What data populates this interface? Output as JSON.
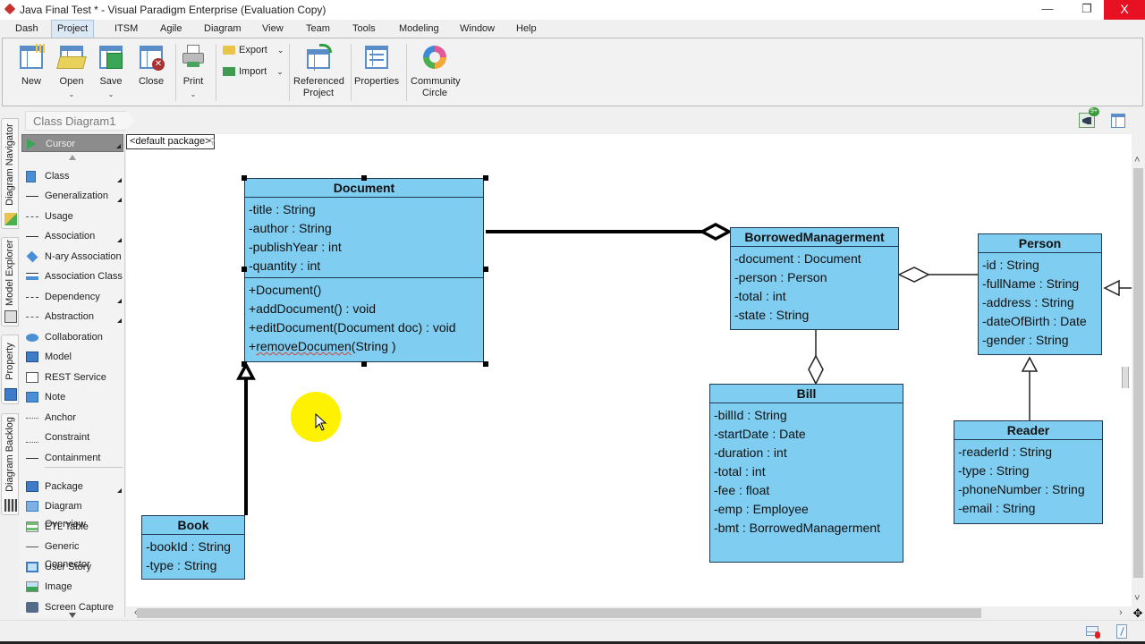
{
  "window": {
    "title": "Java Final Test * - Visual Paradigm Enterprise (Evaluation Copy)",
    "minimize": "—",
    "restore": "❐",
    "close": "X"
  },
  "menu": [
    {
      "label": "Dash"
    },
    {
      "label": "Project",
      "active": true
    },
    {
      "label": "ITSM"
    },
    {
      "label": "Agile"
    },
    {
      "label": "Diagram"
    },
    {
      "label": "View"
    },
    {
      "label": "Team"
    },
    {
      "label": "Tools"
    },
    {
      "label": "Modeling"
    },
    {
      "label": "Window"
    },
    {
      "label": "Help"
    }
  ],
  "ribbon": {
    "new": "New",
    "open": "Open",
    "save": "Save",
    "close": "Close",
    "print": "Print",
    "export": "Export",
    "import": "Import",
    "referenced_project_line1": "Referenced",
    "referenced_project_line2": "Project",
    "properties": "Properties",
    "community_line1": "Community",
    "community_line2": "Circle",
    "dropdown_glyph": "⌄",
    "notification_badge": "9+"
  },
  "diagram_tab": "Class Diagram1",
  "side_tabs": [
    "Diagram Navigator",
    "Model Explorer",
    "Property",
    "Diagram Backlog"
  ],
  "palette": {
    "items": [
      {
        "label": "Cursor",
        "icon": "cursor-icon",
        "selected": true,
        "submenu": true
      },
      {
        "label": "Class",
        "icon": "class-icon",
        "submenu": true
      },
      {
        "label": "Generalization",
        "icon": "generalization-icon",
        "submenu": true
      },
      {
        "label": "Usage",
        "icon": "usage-icon"
      },
      {
        "label": "Association",
        "icon": "association-icon",
        "submenu": true
      },
      {
        "label": "N-ary Association",
        "icon": "nary-association-icon"
      },
      {
        "label": "Association Class",
        "icon": "association-class-icon"
      },
      {
        "label": "Dependency",
        "icon": "dependency-icon",
        "submenu": true
      },
      {
        "label": "Abstraction",
        "icon": "abstraction-icon",
        "submenu": true
      },
      {
        "label": "Collaboration",
        "icon": "collaboration-icon"
      },
      {
        "label": "Model",
        "icon": "model-icon"
      },
      {
        "label": "REST Service",
        "icon": "rest-service-icon"
      },
      {
        "label": "Note",
        "icon": "note-icon"
      },
      {
        "label": "Anchor",
        "icon": "anchor-icon"
      },
      {
        "label": "Constraint",
        "icon": "constraint-icon"
      },
      {
        "label": "Containment",
        "icon": "containment-icon"
      },
      {
        "label": "Package",
        "icon": "package-icon",
        "submenu": true
      },
      {
        "label": "Diagram Overview",
        "icon": "diagram-overview-icon"
      },
      {
        "label": "ETL Table",
        "icon": "etl-table-icon"
      },
      {
        "label": "Generic Connector",
        "icon": "generic-connector-icon"
      },
      {
        "label": "User Story",
        "icon": "user-story-icon"
      },
      {
        "label": "Image",
        "icon": "image-icon"
      },
      {
        "label": "Screen Capture",
        "icon": "screen-capture-icon"
      }
    ]
  },
  "canvas": {
    "package_label": "<default package>",
    "classes": {
      "document": {
        "name": "Document",
        "attributes": [
          "-title : String",
          "-author : String",
          "-publishYear : int",
          "-quantity : int"
        ],
        "operations": [
          "+Document()",
          "+addDocument() : void",
          "+editDocument(Document doc) : void"
        ],
        "op_last_prefix": "+",
        "op_last_name": "removeDocumen",
        "op_last_suffix": "(String )"
      },
      "borrowed": {
        "name": "BorrowedManagerment",
        "attributes": [
          "-document : Document",
          "-person : Person",
          "-total : int",
          "-state : String"
        ]
      },
      "person": {
        "name": "Person",
        "attributes": [
          "-id : String",
          "-fullName : String",
          "-address : String",
          "-dateOfBirth : Date",
          "-gender : String"
        ]
      },
      "bill": {
        "name": "Bill",
        "attributes": [
          "-billId : String",
          "-startDate : Date",
          "-duration : int",
          "-total : int",
          "-fee : float",
          "-emp : Employee",
          "-bmt : BorrowedManagerment"
        ]
      },
      "reader": {
        "name": "Reader",
        "attributes": [
          "-readerId : String",
          "-type : String",
          "-phoneNumber : String",
          "-email : String"
        ]
      },
      "book": {
        "name": "Book",
        "attributes": [
          "-bookId : String",
          "-type : String"
        ]
      }
    },
    "relationships": [
      {
        "type": "aggregation",
        "from": "Document",
        "to": "BorrowedManagerment",
        "selected": true
      },
      {
        "type": "aggregation",
        "from": "Person",
        "to": "BorrowedManagerment"
      },
      {
        "type": "aggregation",
        "from": "Bill",
        "to": "BorrowedManagerment"
      },
      {
        "type": "generalization",
        "from": "Book",
        "to": "Document",
        "selected": true
      },
      {
        "type": "generalization",
        "from": "Reader",
        "to": "Person"
      },
      {
        "type": "generalization",
        "from": "offscreen",
        "to": "Person"
      }
    ]
  },
  "colors": {
    "class_fill": "#7fcdf1",
    "class_border": "#1f3a52",
    "highlight": "#fff200",
    "close_red": "#e81123"
  }
}
